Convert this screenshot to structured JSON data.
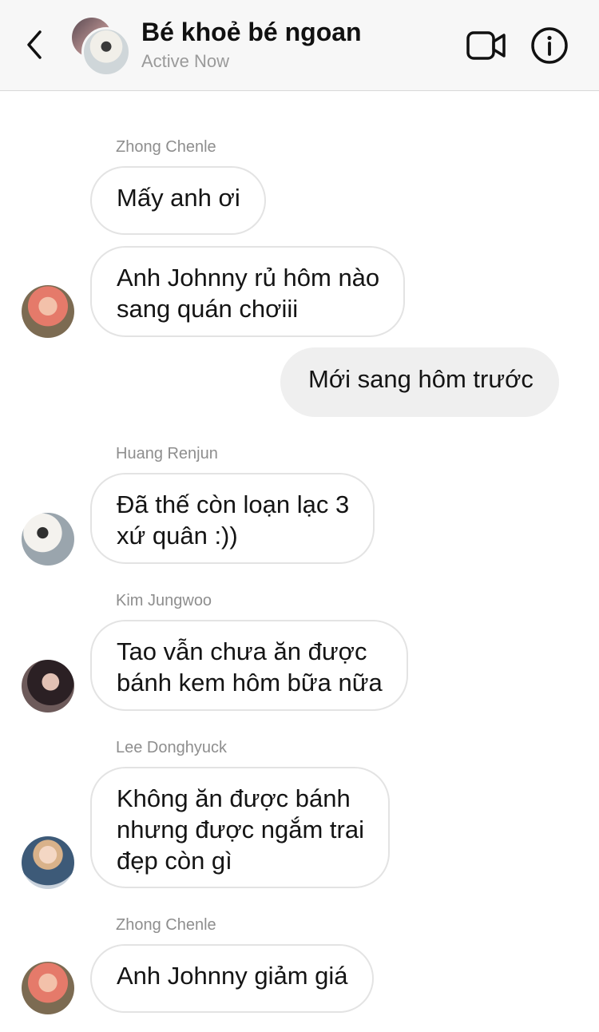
{
  "header": {
    "title": "Bé khoẻ bé ngoan",
    "status": "Active Now",
    "back_icon": "chevron-left-icon",
    "video_icon": "video-camera-icon",
    "info_icon": "info-icon"
  },
  "messages": [
    {
      "sender": "Zhong Chenle",
      "text": "Mấy anh ơi"
    },
    {
      "text": "Anh Johnny rủ hôm nào\nsang quán chơiii"
    },
    {
      "text": "Mới sang hôm trước",
      "outgoing": true
    },
    {
      "sender": "Huang Renjun",
      "text": "Đã thế còn loạn lạc 3\nxứ quân :))"
    },
    {
      "sender": "Kim Jungwoo",
      "text": "Tao vẫn chưa ăn được\nbánh kem hôm bữa nữa"
    },
    {
      "sender": "Lee Donghyuck",
      "text": "Không ăn được bánh\nnhưng được ngắm trai\nđẹp còn gì"
    },
    {
      "sender": "Zhong Chenle",
      "text": "Anh Johnny giảm giá"
    }
  ]
}
